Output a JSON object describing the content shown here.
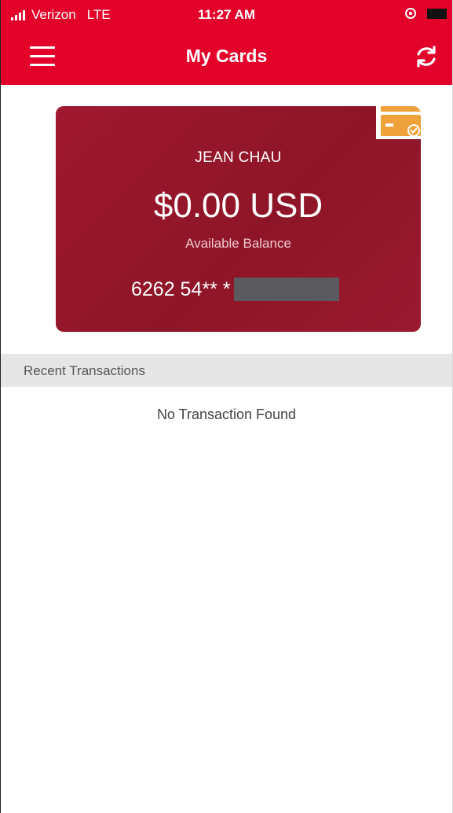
{
  "status_bar": {
    "carrier": "Verizon",
    "network": "LTE",
    "time": "11:27 AM"
  },
  "nav": {
    "title": "My Cards"
  },
  "card": {
    "holder_name": "JEAN CHAU",
    "balance": "$0.00 USD",
    "balance_label": "Available Balance",
    "number_visible": "6262 54** *",
    "badge_icon": "card-check-icon"
  },
  "transactions": {
    "header": "Recent Transactions",
    "empty_message": "No Transaction Found"
  },
  "colors": {
    "brand_red": "#e3022a",
    "card_red": "#921628",
    "badge_orange": "#f0a23a",
    "section_gray": "#e6e6e6"
  }
}
